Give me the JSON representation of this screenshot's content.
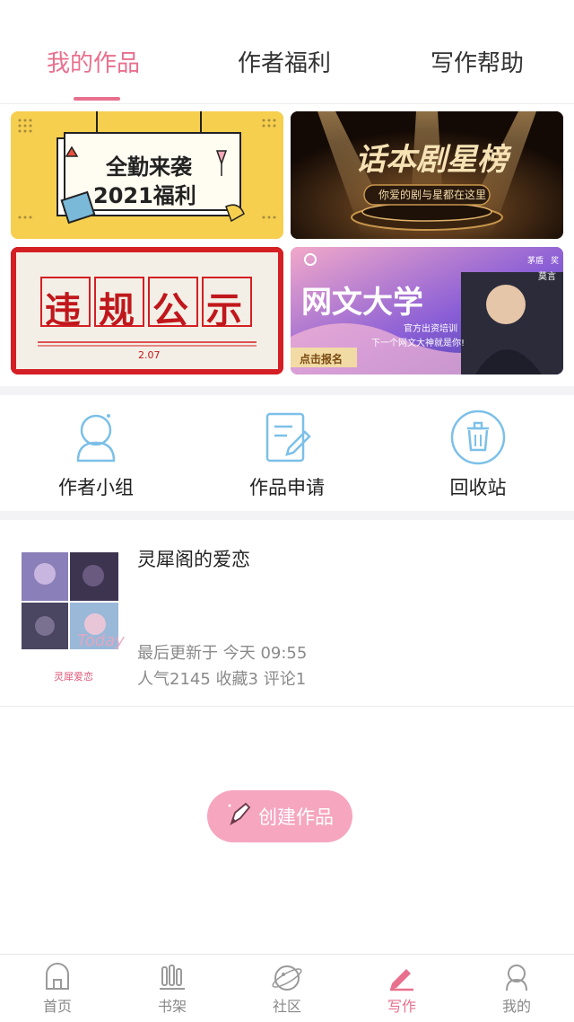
{
  "top_tabs": [
    {
      "label": "我的作品",
      "active": true
    },
    {
      "label": "作者福利",
      "active": false
    },
    {
      "label": "写作帮助",
      "active": false
    }
  ],
  "banners": {
    "fulltime": {
      "title": "全勤来袭",
      "subtitle": "2021福利"
    },
    "drama": {
      "title": "话本剧星榜",
      "subtitle": "你爱的剧与星都在这里"
    },
    "violation": {
      "title": "违规公示",
      "date": "2.07"
    },
    "university": {
      "title": "网文大学",
      "tagline1": "官方出资培训",
      "tagline2": "下一个网文大神就是你!",
      "cta": "点击报名",
      "badge1": "茅盾",
      "badge2": "奖",
      "badge3": "莫言"
    }
  },
  "entries": [
    {
      "label": "作者小组",
      "icon": "user-group-icon"
    },
    {
      "label": "作品申请",
      "icon": "edit-document-icon"
    },
    {
      "label": "回收站",
      "icon": "trash-icon"
    }
  ],
  "work": {
    "title": "灵犀阁的爱恋",
    "cover_caption": "灵犀爱恋",
    "cover_overlay": "Today",
    "updated": "最后更新于 今天 09:55",
    "stats": "人气2145 收藏3 评论1"
  },
  "create_button": {
    "label": "创建作品",
    "icon": "pencil-icon"
  },
  "bottom_nav": [
    {
      "label": "首页",
      "icon": "home-icon",
      "active": false
    },
    {
      "label": "书架",
      "icon": "bookshelf-icon",
      "active": false
    },
    {
      "label": "社区",
      "icon": "community-icon",
      "active": false
    },
    {
      "label": "写作",
      "icon": "write-icon",
      "active": true
    },
    {
      "label": "我的",
      "icon": "profile-icon",
      "active": false
    }
  ],
  "colors": {
    "accent": "#e8708e",
    "create_button": "#f6a6bf",
    "icon_blue": "#7cc0e8"
  }
}
